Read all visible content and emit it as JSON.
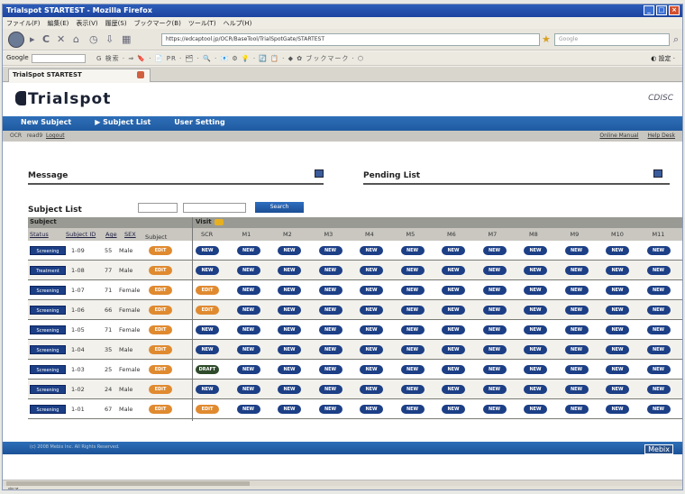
{
  "window": {
    "title": "Trialspot STARTEST - Mozilla Firefox"
  },
  "menubar": [
    "ファイル(F)",
    "編集(E)",
    "表示(V)",
    "履歴(S)",
    "ブックマーク(B)",
    "ツール(T)",
    "ヘルプ(H)"
  ],
  "navbar": {
    "url": "https://edcaptool.jp/OCR/BaseTool/TrialSpotGate/STARTEST",
    "search_placeholder": "Google"
  },
  "google_bar": {
    "label": "Google",
    "tools": "G 検索 · ⇒ 🔖 · 📄 PR · 🗂 · 🔍 · 📧 ⚙ 💡 · 🔄 📋 · ◆ ✿ ブックマーク · ⬡",
    "right": "◐ 設定 ·"
  },
  "tab": {
    "label": "TrialSpot STARTEST"
  },
  "app": {
    "logo": "Trialspot",
    "corp": "CDISC",
    "nav": [
      "New Subject",
      "▶ Subject List",
      "User Setting"
    ],
    "subnav_left": [
      "OCR",
      "read9",
      "Logout"
    ],
    "subnav_right": [
      "Online Manual",
      "Help Desk"
    ]
  },
  "sections": {
    "message": "Message",
    "pending": "Pending List",
    "subject_list": "Subject List"
  },
  "search": {
    "button": "Search"
  },
  "grid": {
    "subject_header": "Subject",
    "visit_header": "Visit",
    "columns": [
      "Status",
      "Subject ID",
      "Age",
      "SEX",
      "Subject Info"
    ],
    "visits": [
      "SCR",
      "M1",
      "M2",
      "M3",
      "M4",
      "M5",
      "M6",
      "M7",
      "M8",
      "M9",
      "M10",
      "M11"
    ],
    "rows": [
      {
        "status": "Screening",
        "id": "1-09",
        "age": "55",
        "sex": "Male",
        "info": "EDIT",
        "cells": [
          "NEW",
          "NEW",
          "NEW",
          "NEW",
          "NEW",
          "NEW",
          "NEW",
          "NEW",
          "NEW",
          "NEW",
          "NEW",
          "NEW"
        ]
      },
      {
        "status": "Treatment",
        "id": "1-08",
        "age": "77",
        "sex": "Male",
        "info": "EDIT",
        "cells": [
          "NEW",
          "NEW",
          "NEW",
          "NEW",
          "NEW",
          "NEW",
          "NEW",
          "NEW",
          "NEW",
          "NEW",
          "NEW",
          "NEW"
        ]
      },
      {
        "status": "Screening",
        "id": "1-07",
        "age": "71",
        "sex": "Female",
        "info": "EDIT",
        "cells": [
          "EDIT",
          "NEW",
          "NEW",
          "NEW",
          "NEW",
          "NEW",
          "NEW",
          "NEW",
          "NEW",
          "NEW",
          "NEW",
          "NEW"
        ]
      },
      {
        "status": "Screening",
        "id": "1-06",
        "age": "66",
        "sex": "Female",
        "info": "EDIT",
        "cells": [
          "EDIT",
          "NEW",
          "NEW",
          "NEW",
          "NEW",
          "NEW",
          "NEW",
          "NEW",
          "NEW",
          "NEW",
          "NEW",
          "NEW"
        ]
      },
      {
        "status": "Screening",
        "id": "1-05",
        "age": "71",
        "sex": "Female",
        "info": "EDIT",
        "cells": [
          "NEW",
          "NEW",
          "NEW",
          "NEW",
          "NEW",
          "NEW",
          "NEW",
          "NEW",
          "NEW",
          "NEW",
          "NEW",
          "NEW"
        ]
      },
      {
        "status": "Screening",
        "id": "1-04",
        "age": "35",
        "sex": "Male",
        "info": "EDIT",
        "cells": [
          "NEW",
          "NEW",
          "NEW",
          "NEW",
          "NEW",
          "NEW",
          "NEW",
          "NEW",
          "NEW",
          "NEW",
          "NEW",
          "NEW"
        ]
      },
      {
        "status": "Screening",
        "id": "1-03",
        "age": "25",
        "sex": "Female",
        "info": "EDIT",
        "cells": [
          "DRAFT",
          "NEW",
          "NEW",
          "NEW",
          "NEW",
          "NEW",
          "NEW",
          "NEW",
          "NEW",
          "NEW",
          "NEW",
          "NEW"
        ]
      },
      {
        "status": "Screening",
        "id": "1-02",
        "age": "24",
        "sex": "Male",
        "info": "EDIT",
        "cells": [
          "NEW",
          "NEW",
          "NEW",
          "NEW",
          "NEW",
          "NEW",
          "NEW",
          "NEW",
          "NEW",
          "NEW",
          "NEW",
          "NEW"
        ]
      },
      {
        "status": "Screening",
        "id": "1-01",
        "age": "67",
        "sex": "Male",
        "info": "EDIT",
        "cells": [
          "EDIT",
          "NEW",
          "NEW",
          "NEW",
          "NEW",
          "NEW",
          "NEW",
          "NEW",
          "NEW",
          "NEW",
          "NEW",
          "NEW"
        ]
      }
    ]
  },
  "footer": {
    "copyright": "(c) 2008 Mebix Inc. All Rights Reserved.",
    "logo": "Mebix"
  },
  "status": {
    "text": "完了"
  },
  "colors": {
    "brand": "#1f5aa0",
    "status_badge": "#1c3f86",
    "edit": "#e08a30",
    "draft": "#2e4a2a"
  }
}
